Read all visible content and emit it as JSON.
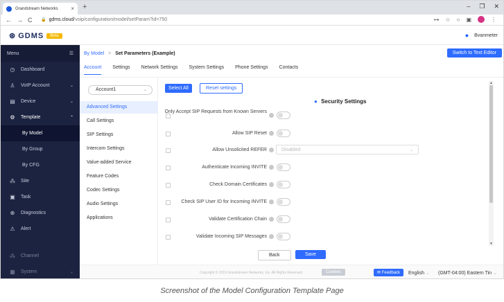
{
  "browser": {
    "tab_title": "Grandstream Networks",
    "tab_close": "×",
    "new_tab": "+",
    "url_domain": "gdms.cloud",
    "url_path": "/voip/configuration/model/setParam?id=750",
    "win_min": "–",
    "win_max": "❐",
    "win_close": "✕"
  },
  "app": {
    "logo_text": "GDMS",
    "beta": "Beta",
    "user": "Bvanmeter"
  },
  "sidebar": {
    "menu_label": "Menu",
    "items": [
      {
        "label": "Dashboard",
        "icon": "◷",
        "chev": ""
      },
      {
        "label": "VoIP Account",
        "icon": "♙",
        "chev": "⌄"
      },
      {
        "label": "Device",
        "icon": "▤",
        "chev": "⌄"
      },
      {
        "label": "Template",
        "icon": "⚙",
        "chev": "⌃"
      }
    ],
    "subitems": [
      {
        "label": "By Model",
        "selected": true
      },
      {
        "label": "By Group",
        "selected": false
      },
      {
        "label": "By CFG",
        "selected": false
      }
    ],
    "items2": [
      {
        "label": "Site",
        "icon": "⁂"
      },
      {
        "label": "Task",
        "icon": "▣"
      },
      {
        "label": "Diagnostics",
        "icon": "⊕"
      },
      {
        "label": "Alert",
        "icon": "⚠"
      },
      {
        "label": "Channel",
        "icon": "⁂"
      },
      {
        "label": "System",
        "icon": "▦"
      }
    ]
  },
  "main": {
    "crumb_link": "By Model",
    "crumb_sep": ">",
    "crumb_current": "Set Parameters (Example)",
    "switch_btn": "Switch to Text Editor",
    "tabs": [
      "Account",
      "Settings",
      "Network Settings",
      "System Settings",
      "Phone Settings",
      "Contacts"
    ],
    "account_select": "Account1",
    "left_list": [
      "Advanced Settings",
      "Call Settings",
      "SIP Settings",
      "Intercom Settings",
      "Value-added Service",
      "Feature Codes",
      "Codec Settings",
      "Audio Settings",
      "Applications"
    ],
    "select_all": "Select All",
    "reset": "Reset settings",
    "section_title": "Security Settings",
    "rows": [
      {
        "label": "Only Accept SIP Requests from Known Servers",
        "type": "toggle"
      },
      {
        "label": "Allow SIP Reset",
        "type": "toggle"
      },
      {
        "label": "Allow Unsolicited REFER",
        "type": "select",
        "value": "Disabled"
      },
      {
        "label": "Authenticate Incoming INVITE",
        "type": "toggle"
      },
      {
        "label": "Check Domain Certificates",
        "type": "toggle"
      },
      {
        "label": "Check SIP User ID for Incoming INVITE",
        "type": "toggle"
      },
      {
        "label": "Validate Certification Chain",
        "type": "toggle"
      },
      {
        "label": "Validate Incoming SIP Messages",
        "type": "toggle"
      }
    ],
    "back": "Back",
    "save": "Save"
  },
  "footer": {
    "copyright": "Copyright © 2019 Grandstream Networks, Inc. All Rights Reserved.",
    "cookies": "Cookies",
    "feedback": "Feedback",
    "language": "English",
    "timezone": "(GMT-04:00) Eastern Tin"
  },
  "caption": "Screenshot of the Model Configuration Template Page",
  "colors": {
    "accent": "#2f6bff",
    "sidebar": "#1c2340",
    "beta": "#f5b900"
  }
}
